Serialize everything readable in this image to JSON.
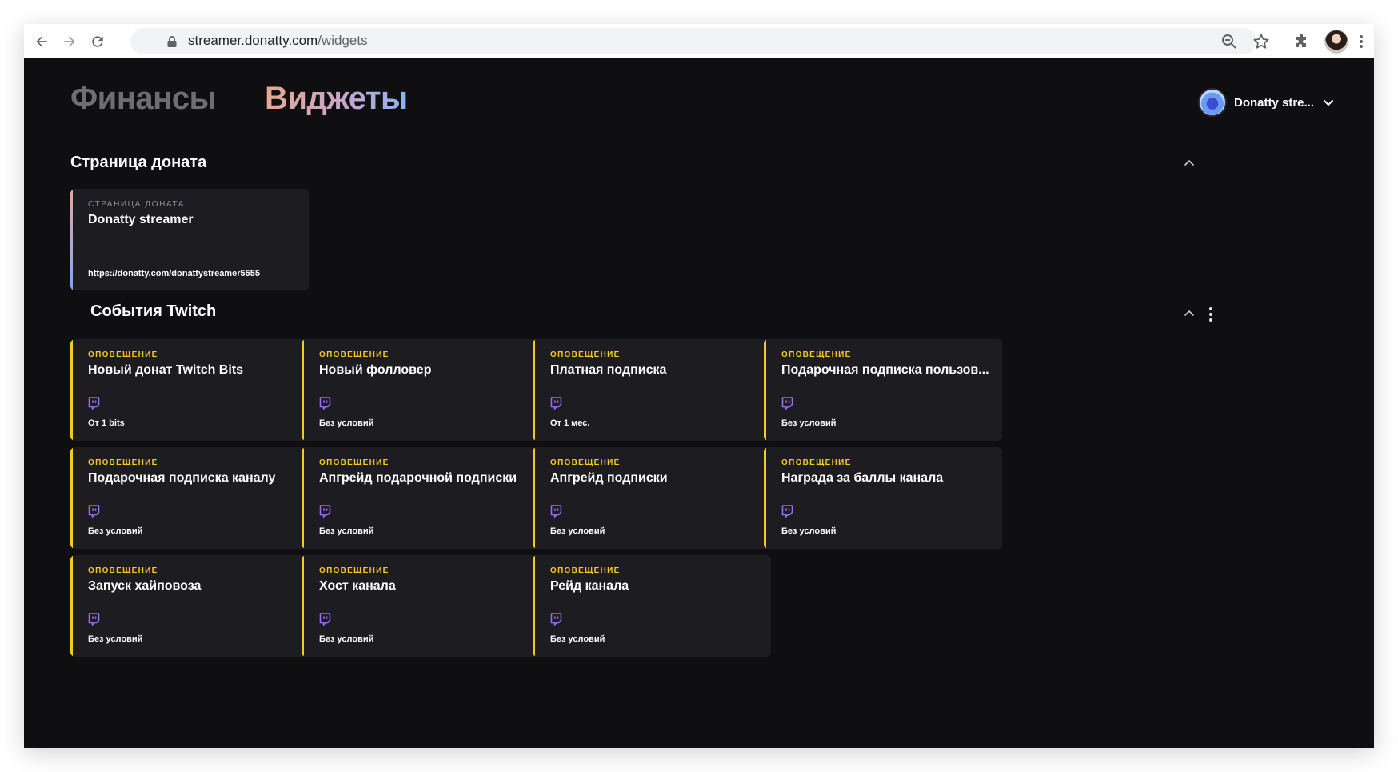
{
  "browser": {
    "url_host": "streamer.donatty.com",
    "url_path": "/widgets"
  },
  "header": {
    "tabs": [
      {
        "label": "Финансы",
        "active": false
      },
      {
        "label": "Виджеты",
        "active": true
      }
    ],
    "user": {
      "name": "Donatty stre..."
    }
  },
  "sections": {
    "donation_page": {
      "title": "Страница доната",
      "card": {
        "kicker": "СТРАНИЦА ДОНАТА",
        "title": "Donatty streamer",
        "url": "https://donatty.com/donattystreamer5555"
      }
    },
    "twitch_events": {
      "title": "События Twitch",
      "cards": [
        {
          "kicker": "ОПОВЕЩЕНИЕ",
          "title": "Новый донат Twitch Bits",
          "condition": "От 1 bits"
        },
        {
          "kicker": "ОПОВЕЩЕНИЕ",
          "title": "Новый фолловер",
          "condition": "Без условий"
        },
        {
          "kicker": "ОПОВЕЩЕНИЕ",
          "title": "Платная подписка",
          "condition": "От 1 мес."
        },
        {
          "kicker": "ОПОВЕЩЕНИЕ",
          "title": "Подарочная подписка пользов...",
          "condition": "Без условий"
        },
        {
          "kicker": "ОПОВЕЩЕНИЕ",
          "title": "Подарочная подписка каналу",
          "condition": "Без условий"
        },
        {
          "kicker": "ОПОВЕЩЕНИЕ",
          "title": "Апгрейд подарочной подписки",
          "condition": "Без условий"
        },
        {
          "kicker": "ОПОВЕЩЕНИЕ",
          "title": "Апгрейд подписки",
          "condition": "Без условий"
        },
        {
          "kicker": "ОПОВЕЩЕНИЕ",
          "title": "Награда за баллы канала",
          "condition": "Без условий"
        },
        {
          "kicker": "ОПОВЕЩЕНИЕ",
          "title": "Запуск хайповоза",
          "condition": "Без условий"
        },
        {
          "kicker": "ОПОВЕЩЕНИЕ",
          "title": "Хост канала",
          "condition": "Без условий"
        },
        {
          "kicker": "ОПОВЕЩЕНИЕ",
          "title": "Рейд канала",
          "condition": "Без условий"
        }
      ]
    }
  },
  "colors": {
    "background": "#0f0f11",
    "card": "#1d1d21",
    "accent_yellow": "#f5c922",
    "twitch_purple": "#9b6cf0"
  },
  "icons": [
    "back-icon",
    "forward-icon",
    "reload-icon",
    "lock-icon",
    "zoom-icon",
    "star-icon",
    "extensions-icon",
    "more-vert-icon",
    "chevron-down-icon",
    "chevron-up-icon",
    "drag-handle-icon",
    "link-icon",
    "twitch-icon"
  ]
}
